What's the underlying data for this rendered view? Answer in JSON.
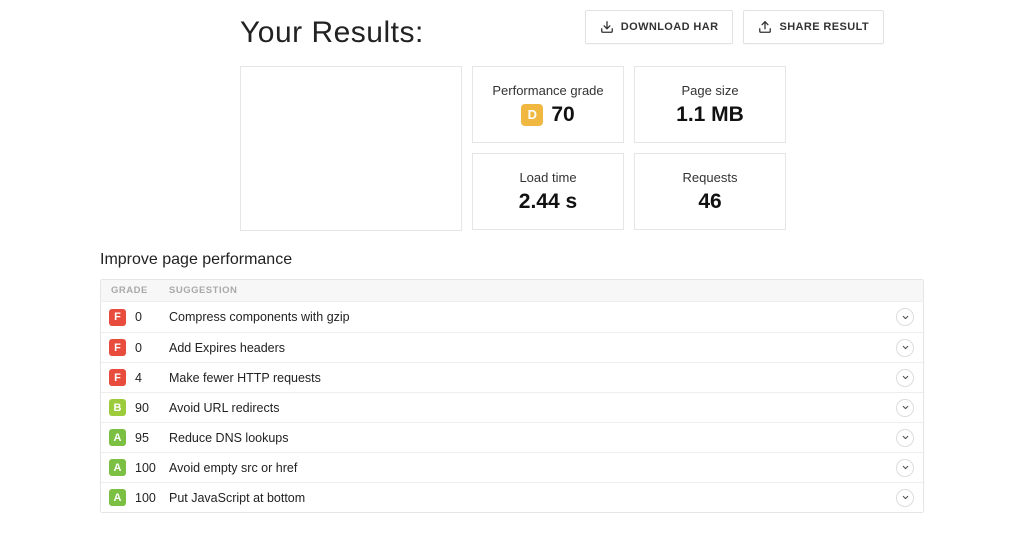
{
  "header": {
    "title": "Your Results:",
    "download_har": "DOWNLOAD HAR",
    "share_result": "SHARE RESULT"
  },
  "metrics": {
    "perf": {
      "label": "Performance grade",
      "grade_letter": "D",
      "grade_color": "g-D",
      "value": "70"
    },
    "page_size": {
      "label": "Page size",
      "value": "1.1 MB"
    },
    "load_time": {
      "label": "Load time",
      "value": "2.44 s"
    },
    "requests": {
      "label": "Requests",
      "value": "46"
    }
  },
  "improve": {
    "title": "Improve page performance",
    "columns": {
      "grade": "GRADE",
      "suggestion": "SUGGESTION"
    },
    "rows": [
      {
        "letter": "F",
        "color": "g-F",
        "score": "0",
        "suggestion": "Compress components with gzip"
      },
      {
        "letter": "F",
        "color": "g-F",
        "score": "0",
        "suggestion": "Add Expires headers"
      },
      {
        "letter": "F",
        "color": "g-F",
        "score": "4",
        "suggestion": "Make fewer HTTP requests"
      },
      {
        "letter": "B",
        "color": "g-B",
        "score": "90",
        "suggestion": "Avoid URL redirects"
      },
      {
        "letter": "A",
        "color": "g-A",
        "score": "95",
        "suggestion": "Reduce DNS lookups"
      },
      {
        "letter": "A",
        "color": "g-A",
        "score": "100",
        "suggestion": "Avoid empty src or href"
      },
      {
        "letter": "A",
        "color": "g-A",
        "score": "100",
        "suggestion": "Put JavaScript at bottom"
      }
    ]
  }
}
